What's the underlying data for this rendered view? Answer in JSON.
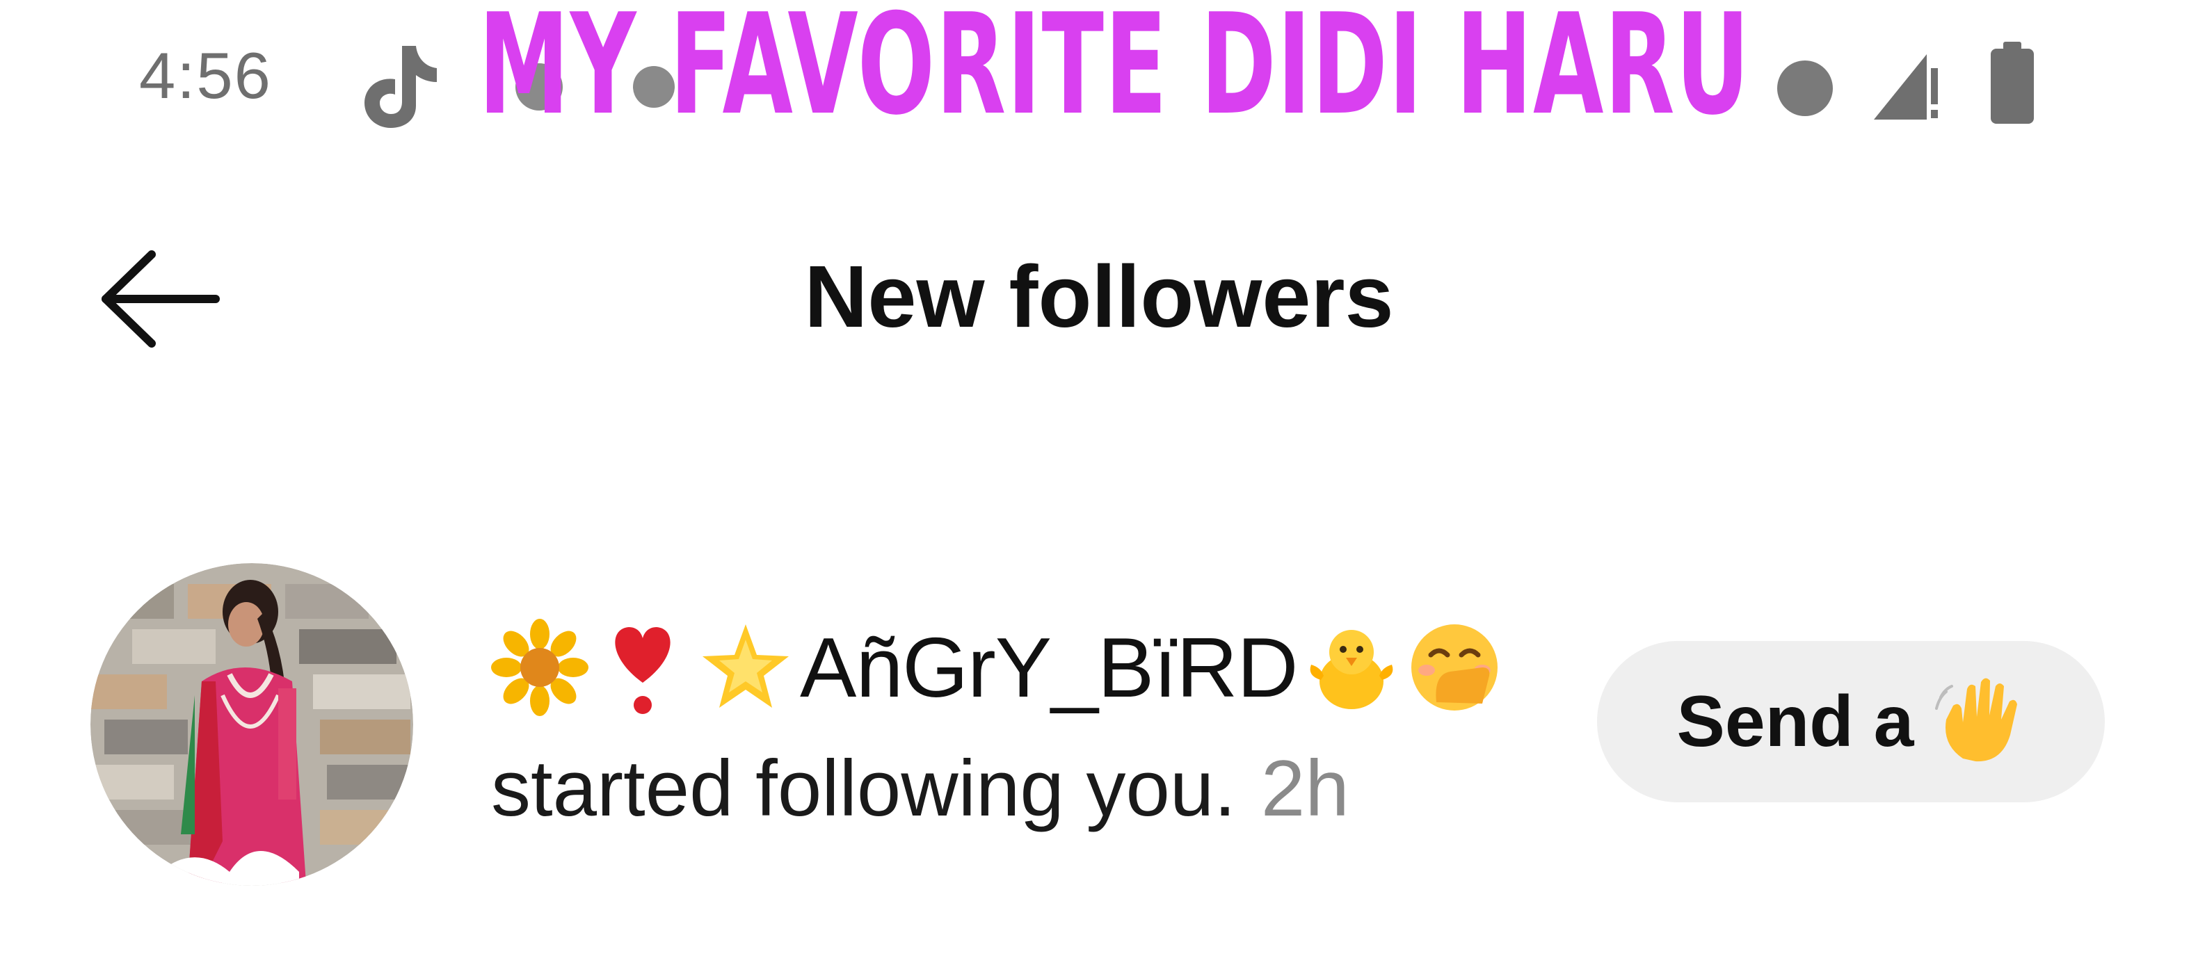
{
  "status_bar": {
    "time": "4:56",
    "icons": [
      "tiktok-icon",
      "notification-icon",
      "notification-icon",
      "notification-icon",
      "signal-icon",
      "battery-icon"
    ]
  },
  "overlay": {
    "caption": "MY FAVORITE DIDI HARU",
    "color": "#d940f0"
  },
  "header": {
    "back_icon": "arrow-left-icon",
    "title": "New followers"
  },
  "notifications": [
    {
      "avatar": "avatar",
      "username_emojis_before": [
        "sunflower-emoji",
        "heart-exclamation-emoji",
        "glowing-star-emoji"
      ],
      "username": "AñGrY_BïRD",
      "username_emojis_after": [
        "baby-chick-emoji",
        "hand-over-mouth-emoji"
      ],
      "activity": "started following you.",
      "time": "2h",
      "action_label": "Send a",
      "action_icon": "waving-hand-emoji"
    }
  ],
  "colors": {
    "button_bg": "#efefef",
    "text_primary": "#111111",
    "text_secondary": "#8a8a8a"
  }
}
